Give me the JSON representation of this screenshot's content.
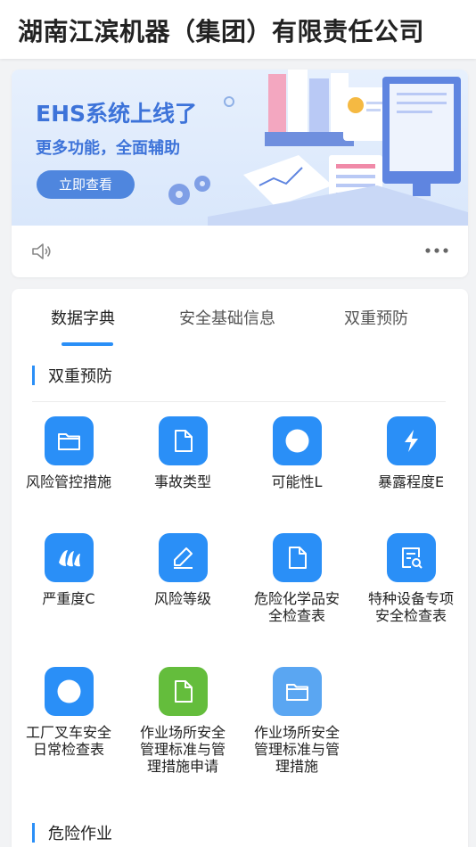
{
  "header": {
    "title": "湖南江滨机器（集团）有限责任公司"
  },
  "banner": {
    "headline": "EHS系统上线了",
    "subline": "更多功能，全面辅助",
    "button_label": "立即查看"
  },
  "tabs": [
    {
      "label": "数据字典",
      "active": true
    },
    {
      "label": "安全基础信息",
      "active": false
    },
    {
      "label": "双重预防",
      "active": false
    }
  ],
  "sections": [
    {
      "title": "双重预防",
      "items": [
        {
          "label": "风险管控措施",
          "icon": "folder-icon"
        },
        {
          "label": "事故类型",
          "icon": "document-icon"
        },
        {
          "label": "可能性L",
          "icon": "circle-icon"
        },
        {
          "label": "暴露程度E",
          "icon": "lightning-icon"
        },
        {
          "label": "严重度C",
          "icon": "banana-icon"
        },
        {
          "label": "风险等级",
          "icon": "pencil-icon"
        },
        {
          "label": "危险化学品安全检查表",
          "icon": "document-icon"
        },
        {
          "label": "特种设备专项安全检查表",
          "icon": "checklist-search-icon"
        },
        {
          "label": "工厂叉车安全日常检查表",
          "icon": "circle-icon"
        },
        {
          "label": "作业场所安全管理标准与管理措施申请",
          "icon": "document-icon"
        },
        {
          "label": "作业场所安全管理标准与管理措施",
          "icon": "folder-icon"
        }
      ]
    },
    {
      "title": "危险作业"
    }
  ],
  "colors": {
    "accent": "#2a8ff7",
    "green": "#64bd3c",
    "banner_text": "#3d73d9"
  }
}
